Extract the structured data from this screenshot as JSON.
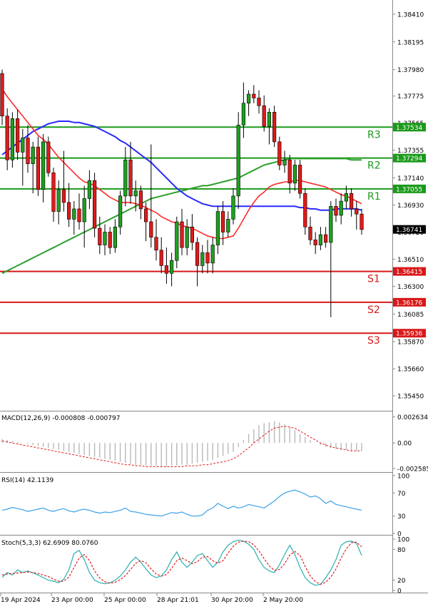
{
  "chart_data": {
    "type": "candlestick",
    "price_axis": {
      "ticks": [
        "1.38410",
        "1.38195",
        "1.37980",
        "1.37775",
        "1.37565",
        "1.37355",
        "1.37140",
        "1.36930",
        "1.36720",
        "1.36510",
        "1.36300",
        "1.36085",
        "1.35870",
        "1.35660",
        "1.35450"
      ],
      "ylim": [
        1.3534,
        1.3852
      ]
    },
    "levels": [
      {
        "label": "R3",
        "value": 1.37534,
        "value_text": "1.37534",
        "color": "#1a9a1a"
      },
      {
        "label": "R2",
        "value": 1.37294,
        "value_text": "1.37294",
        "color": "#1a9a1a"
      },
      {
        "label": "R1",
        "value": 1.37055,
        "value_text": "1.37055",
        "color": "#1a9a1a"
      },
      {
        "label": "S1",
        "value": 1.36415,
        "value_text": "1.36415",
        "color": "#d81818"
      },
      {
        "label": "S2",
        "value": 1.36176,
        "value_text": "1.36176",
        "color": "#d81818"
      },
      {
        "label": "S3",
        "value": 1.35936,
        "value_text": "1.35936",
        "color": "#d81818"
      }
    ],
    "current_price": {
      "value": 1.36741,
      "text": "1.36741"
    },
    "time_labels": [
      "19 Apr 2024",
      "23 Apr 00:00",
      "25 Apr 00:00",
      "28 Apr 21:01",
      "30 Apr 20:00",
      "2 May 20:00"
    ],
    "candles": [
      [
        1.3795,
        1.3798,
        1.3755,
        1.3762
      ],
      [
        1.3762,
        1.3768,
        1.372,
        1.3728
      ],
      [
        1.3728,
        1.3765,
        1.3722,
        1.376
      ],
      [
        1.376,
        1.3767,
        1.3728,
        1.3734
      ],
      [
        1.3734,
        1.3752,
        1.3708,
        1.3745
      ],
      [
        1.3745,
        1.3755,
        1.3718,
        1.3725
      ],
      [
        1.3725,
        1.3742,
        1.3702,
        1.3738
      ],
      [
        1.3738,
        1.3746,
        1.37,
        1.3705
      ],
      [
        1.3705,
        1.3748,
        1.3695,
        1.3742
      ],
      [
        1.3742,
        1.3746,
        1.3715,
        1.3718
      ],
      [
        1.3718,
        1.3722,
        1.368,
        1.3688
      ],
      [
        1.3688,
        1.3712,
        1.3678,
        1.3705
      ],
      [
        1.3705,
        1.3735,
        1.3688,
        1.3695
      ],
      [
        1.3695,
        1.371,
        1.3676,
        1.3682
      ],
      [
        1.3682,
        1.3696,
        1.367,
        1.369
      ],
      [
        1.369,
        1.3702,
        1.3674,
        1.368
      ],
      [
        1.368,
        1.3708,
        1.366,
        1.3698
      ],
      [
        1.3698,
        1.372,
        1.369,
        1.3712
      ],
      [
        1.3712,
        1.3718,
        1.3668,
        1.3675
      ],
      [
        1.3675,
        1.3684,
        1.3655,
        1.3662
      ],
      [
        1.3662,
        1.3678,
        1.3654,
        1.3672
      ],
      [
        1.3672,
        1.3676,
        1.3655,
        1.366
      ],
      [
        1.366,
        1.3682,
        1.3656,
        1.3676
      ],
      [
        1.3676,
        1.3704,
        1.367,
        1.37
      ],
      [
        1.37,
        1.3738,
        1.3692,
        1.3728
      ],
      [
        1.3728,
        1.3742,
        1.3694,
        1.37
      ],
      [
        1.37,
        1.3712,
        1.3688,
        1.3704
      ],
      [
        1.3704,
        1.3708,
        1.3682,
        1.369
      ],
      [
        1.369,
        1.3695,
        1.3665,
        1.368
      ],
      [
        1.368,
        1.374,
        1.366,
        1.3668
      ],
      [
        1.3668,
        1.3682,
        1.365,
        1.3658
      ],
      [
        1.3658,
        1.3668,
        1.364,
        1.3646
      ],
      [
        1.3646,
        1.366,
        1.3632,
        1.364
      ],
      [
        1.364,
        1.3656,
        1.363,
        1.365
      ],
      [
        1.365,
        1.3684,
        1.3644,
        1.368
      ],
      [
        1.368,
        1.369,
        1.3654,
        1.366
      ],
      [
        1.366,
        1.3682,
        1.3654,
        1.3676
      ],
      [
        1.3676,
        1.3686,
        1.3658,
        1.3664
      ],
      [
        1.3664,
        1.3668,
        1.363,
        1.3646
      ],
      [
        1.3646,
        1.3662,
        1.364,
        1.3656
      ],
      [
        1.3656,
        1.3666,
        1.364,
        1.3648
      ],
      [
        1.3648,
        1.3668,
        1.364,
        1.3662
      ],
      [
        1.3662,
        1.3692,
        1.3655,
        1.3688
      ],
      [
        1.3688,
        1.3696,
        1.3662,
        1.3672
      ],
      [
        1.3672,
        1.3688,
        1.3668,
        1.3682
      ],
      [
        1.3682,
        1.3706,
        1.3678,
        1.37
      ],
      [
        1.37,
        1.3765,
        1.369,
        1.3755
      ],
      [
        1.3755,
        1.3788,
        1.3745,
        1.3772
      ],
      [
        1.3772,
        1.3782,
        1.3762,
        1.3779
      ],
      [
        1.3779,
        1.3786,
        1.3772,
        1.3776
      ],
      [
        1.3776,
        1.3782,
        1.3764,
        1.377
      ],
      [
        1.377,
        1.3778,
        1.375,
        1.3754
      ],
      [
        1.3754,
        1.3768,
        1.374,
        1.3765
      ],
      [
        1.3765,
        1.377,
        1.3738,
        1.3742
      ],
      [
        1.3742,
        1.3746,
        1.372,
        1.3724
      ],
      [
        1.3724,
        1.3735,
        1.3718,
        1.3728
      ],
      [
        1.3728,
        1.3732,
        1.3702,
        1.371
      ],
      [
        1.371,
        1.3728,
        1.3704,
        1.3724
      ],
      [
        1.3724,
        1.3728,
        1.3698,
        1.3702
      ],
      [
        1.3702,
        1.3706,
        1.367,
        1.3676
      ],
      [
        1.3676,
        1.3684,
        1.3662,
        1.3666
      ],
      [
        1.3666,
        1.3672,
        1.3655,
        1.3662
      ],
      [
        1.3662,
        1.3676,
        1.3658,
        1.367
      ],
      [
        1.367,
        1.3676,
        1.366,
        1.3664
      ],
      [
        1.3664,
        1.3696,
        1.3606,
        1.3692
      ],
      [
        1.3692,
        1.3698,
        1.368,
        1.3685
      ],
      [
        1.3685,
        1.3702,
        1.3678,
        1.3696
      ],
      [
        1.3696,
        1.3708,
        1.369,
        1.3702
      ],
      [
        1.3702,
        1.3706,
        1.3684,
        1.369
      ],
      [
        1.369,
        1.3696,
        1.3674,
        1.3686
      ],
      [
        1.3686,
        1.369,
        1.367,
        1.3674
      ]
    ],
    "ema_red": [
      1.3783,
      1.3777,
      1.3772,
      1.3767,
      1.3762,
      1.3757,
      1.3752,
      1.3747,
      1.3744,
      1.374,
      1.3735,
      1.373,
      1.3726,
      1.3722,
      1.3718,
      1.3714,
      1.3711,
      1.371,
      1.3708,
      1.3705,
      1.3702,
      1.3699,
      1.3697,
      1.3695,
      1.3695,
      1.3695,
      1.3694,
      1.3693,
      1.3691,
      1.3689,
      1.3687,
      1.3684,
      1.3682,
      1.368,
      1.3679,
      1.3677,
      1.3676,
      1.3675,
      1.3673,
      1.3671,
      1.3669,
      1.3668,
      1.3667,
      1.3667,
      1.3668,
      1.3669,
      1.3675,
      1.3682,
      1.3689,
      1.3695,
      1.37,
      1.3703,
      1.3707,
      1.3709,
      1.371,
      1.3711,
      1.3711,
      1.3712,
      1.3712,
      1.3711,
      1.371,
      1.3709,
      1.3708,
      1.3707,
      1.3705,
      1.3703,
      1.3701,
      1.37,
      1.3698,
      1.3696,
      1.3694
    ],
    "ema_blue": [
      1.3732,
      1.3735,
      1.3738,
      1.3741,
      1.3744,
      1.3747,
      1.375,
      1.3752,
      1.3754,
      1.3756,
      1.3757,
      1.3758,
      1.3758,
      1.3758,
      1.3757,
      1.3757,
      1.3756,
      1.3755,
      1.3754,
      1.3752,
      1.375,
      1.3748,
      1.3746,
      1.3743,
      1.3741,
      1.3738,
      1.3735,
      1.3732,
      1.3729,
      1.3726,
      1.3722,
      1.3718,
      1.3714,
      1.371,
      1.3706,
      1.3703,
      1.37,
      1.3698,
      1.3696,
      1.3694,
      1.3693,
      1.3692,
      1.3692,
      1.3692,
      1.3692,
      1.3692,
      1.3692,
      1.3692,
      1.3692,
      1.3692,
      1.3692,
      1.3692,
      1.3692,
      1.3692,
      1.3692,
      1.3692,
      1.3692,
      1.3692,
      1.3691,
      1.3691,
      1.369,
      1.369,
      1.3689,
      1.3689,
      1.3689,
      1.369,
      1.369,
      1.369,
      1.369,
      1.369,
      1.3689
    ],
    "ema_green": [
      1.364,
      1.3642,
      1.3644,
      1.3646,
      1.3648,
      1.365,
      1.3652,
      1.3654,
      1.3656,
      1.3658,
      1.366,
      1.3662,
      1.3664,
      1.3666,
      1.3668,
      1.367,
      1.3672,
      1.3674,
      1.3676,
      1.3678,
      1.368,
      1.3682,
      1.3684,
      1.3686,
      1.3688,
      1.369,
      1.3692,
      1.3694,
      1.3696,
      1.3698,
      1.3699,
      1.37,
      1.3701,
      1.3702,
      1.3703,
      1.3704,
      1.3705,
      1.3706,
      1.3707,
      1.3708,
      1.3708,
      1.3709,
      1.371,
      1.3711,
      1.3712,
      1.3713,
      1.3714,
      1.3716,
      1.3718,
      1.372,
      1.3722,
      1.3724,
      1.3725,
      1.3726,
      1.3727,
      1.3728,
      1.3729,
      1.3729,
      1.3729,
      1.3729,
      1.3729,
      1.3729,
      1.3729,
      1.3729,
      1.3729,
      1.3729,
      1.3729,
      1.3729,
      1.3728,
      1.3728,
      1.3728
    ],
    "macd": {
      "label": "MACD(12,26,9) -0.000808 -0.000797",
      "ticks": [
        "0.002634",
        "0.00",
        "-0.002585"
      ],
      "ylim": [
        -0.0028,
        0.0029
      ],
      "zero": 0,
      "hist": [
        0.0004,
        0.0003,
        0.0002,
        0.0001,
        0.0,
        -0.0001,
        -0.0002,
        -0.0003,
        -0.0004,
        -0.0005,
        -0.0006,
        -0.0007,
        -0.0008,
        -0.0009,
        -0.001,
        -0.0011,
        -0.0012,
        -0.0013,
        -0.0014,
        -0.0015,
        -0.0016,
        -0.0017,
        -0.0018,
        -0.0019,
        -0.002,
        -0.0021,
        -0.0022,
        -0.0022,
        -0.0023,
        -0.0023,
        -0.0023,
        -0.0024,
        -0.0024,
        -0.0023,
        -0.0023,
        -0.0022,
        -0.0022,
        -0.0021,
        -0.002,
        -0.0019,
        -0.0018,
        -0.0017,
        -0.0015,
        -0.0013,
        -0.0011,
        -0.0009,
        -0.0004,
        0.0003,
        0.0009,
        0.0014,
        0.0018,
        0.002,
        0.0021,
        0.0022,
        0.0021,
        0.0019,
        0.0016,
        0.0013,
        0.0009,
        0.0006,
        0.0003,
        0.0,
        -0.0002,
        -0.0004,
        -0.0005,
        -0.0006,
        -0.0007,
        -0.0007,
        -0.0008,
        -0.0008,
        -0.0008
      ],
      "signal": [
        0.0002,
        0.0001,
        0.0,
        -0.0001,
        -0.0002,
        -0.0003,
        -0.0004,
        -0.0005,
        -0.0006,
        -0.0007,
        -0.0008,
        -0.0009,
        -0.001,
        -0.0011,
        -0.0012,
        -0.0013,
        -0.0014,
        -0.0015,
        -0.0016,
        -0.0017,
        -0.0018,
        -0.0019,
        -0.002,
        -0.0021,
        -0.0022,
        -0.0022,
        -0.0023,
        -0.0023,
        -0.0024,
        -0.0024,
        -0.0024,
        -0.0024,
        -0.0024,
        -0.0024,
        -0.0024,
        -0.0024,
        -0.0023,
        -0.0023,
        -0.0023,
        -0.0022,
        -0.0022,
        -0.0021,
        -0.002,
        -0.0019,
        -0.0018,
        -0.0016,
        -0.0013,
        -0.0009,
        -0.0005,
        0.0,
        0.0004,
        0.0008,
        0.0012,
        0.0015,
        0.0016,
        0.0017,
        0.0016,
        0.0015,
        0.0012,
        0.0009,
        0.0006,
        0.0003,
        0.0,
        -0.0002,
        -0.0004,
        -0.0005,
        -0.0006,
        -0.0007,
        -0.0008,
        -0.0008,
        -0.0008
      ]
    },
    "rsi": {
      "label": "RSI(14) 42.1139",
      "ticks": [
        "100",
        "70",
        "30",
        "0"
      ],
      "ylim": [
        0,
        100
      ],
      "values": [
        40,
        42,
        45,
        43,
        41,
        38,
        40,
        42,
        44,
        40,
        38,
        41,
        43,
        39,
        37,
        40,
        42,
        40,
        37,
        35,
        37,
        36,
        38,
        40,
        44,
        38,
        37,
        35,
        33,
        32,
        31,
        30,
        33,
        36,
        35,
        37,
        33,
        30,
        30,
        32,
        40,
        44,
        52,
        47,
        43,
        47,
        44,
        46,
        50,
        48,
        46,
        44,
        50,
        56,
        64,
        70,
        73,
        75,
        72,
        68,
        63,
        65,
        60,
        52,
        56,
        50,
        48,
        46,
        44,
        42,
        40
      ]
    },
    "stoch": {
      "label": "Stoch(5,3,3) 62.6909 80.0760",
      "ticks": [
        "100",
        "80",
        "20",
        "0"
      ],
      "ylim": [
        0,
        100
      ],
      "k": [
        25,
        35,
        30,
        40,
        35,
        38,
        34,
        30,
        25,
        20,
        18,
        15,
        22,
        40,
        72,
        78,
        60,
        35,
        20,
        15,
        13,
        15,
        20,
        28,
        40,
        55,
        65,
        55,
        42,
        30,
        25,
        28,
        40,
        60,
        75,
        55,
        45,
        55,
        68,
        72,
        58,
        45,
        55,
        75,
        88,
        95,
        98,
        96,
        90,
        80,
        60,
        45,
        38,
        35,
        50,
        70,
        88,
        70,
        45,
        25,
        15,
        10,
        12,
        25,
        40,
        60,
        88,
        95,
        96,
        92,
        68
      ],
      "d": [
        30,
        32,
        33,
        34,
        35,
        36,
        35,
        33,
        30,
        27,
        22,
        18,
        18,
        26,
        45,
        63,
        70,
        58,
        38,
        24,
        17,
        14,
        16,
        21,
        29,
        41,
        53,
        58,
        54,
        42,
        32,
        28,
        31,
        43,
        58,
        63,
        58,
        52,
        56,
        65,
        66,
        58,
        53,
        58,
        73,
        86,
        94,
        96,
        95,
        89,
        77,
        62,
        48,
        39,
        41,
        52,
        69,
        76,
        68,
        47,
        28,
        17,
        12,
        16,
        26,
        42,
        63,
        81,
        93,
        94,
        85
      ]
    }
  }
}
